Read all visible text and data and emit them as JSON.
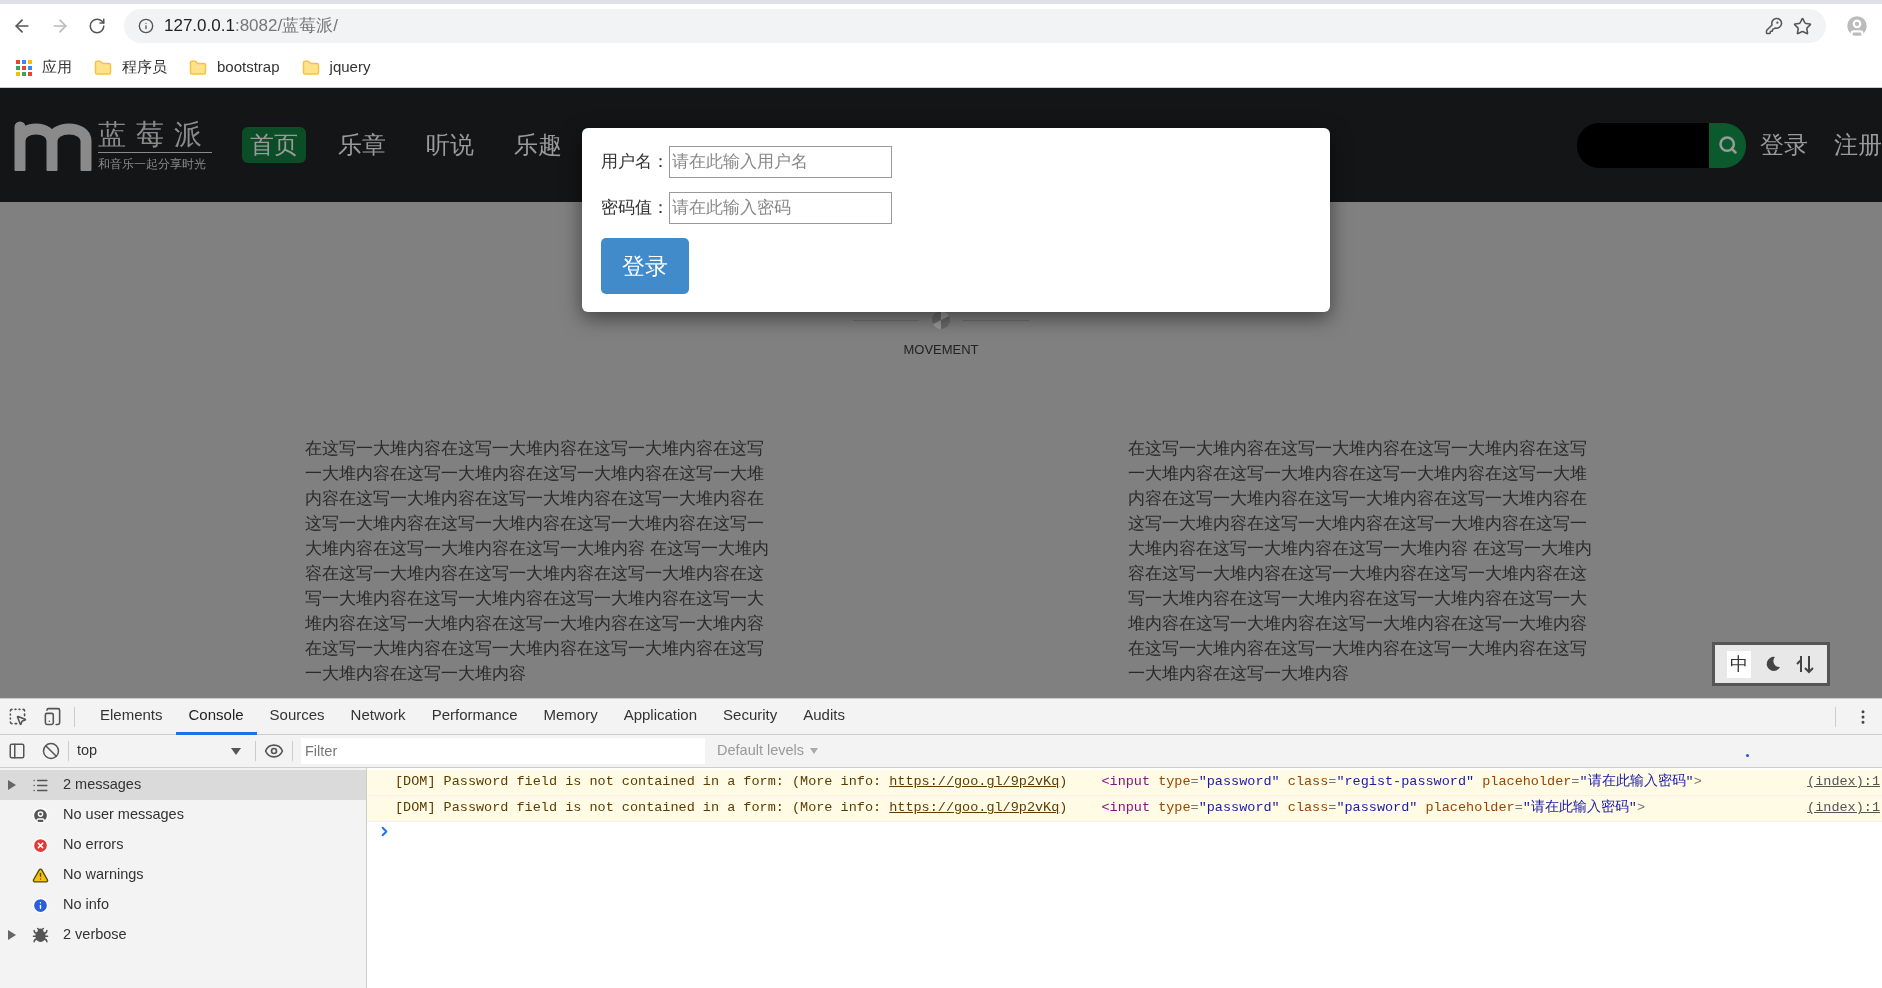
{
  "browser": {
    "url_host": "127.0.0.1",
    "url_path": ":8082/蓝莓派/",
    "bookmarks": [
      {
        "kind": "apps",
        "label": "应用"
      },
      {
        "kind": "folder",
        "label": "程序员"
      },
      {
        "kind": "folder",
        "label": "bootstrap"
      },
      {
        "kind": "folder",
        "label": "jquery"
      }
    ]
  },
  "site": {
    "logo_title": "蓝莓派",
    "logo_slogan": "和音乐一起分享时光",
    "nav": [
      {
        "label": "首页",
        "selected": true
      },
      {
        "label": "乐章",
        "selected": false
      },
      {
        "label": "听说",
        "selected": false
      },
      {
        "label": "乐趣",
        "selected": false
      }
    ],
    "auth_links": [
      "登录",
      "注册"
    ],
    "section_label": "MOVEMENT",
    "paragraphs": [
      "在这写一大堆内容在这写一大堆内容在这写一大堆内容在这写一大堆内容在这写一大堆内容在这写一大堆内容在这写一大堆内容在这写一大堆内容在这写一大堆内容在这写一大堆内容在这写一大堆内容在这写一大堆内容在这写一大堆内容在这写一大堆内容在这写一大堆内容在这写一大堆内容 在这写一大堆内容在这写一大堆内容在这写一大堆内容在这写一大堆内容在这写一大堆内容在这写一大堆内容在这写一大堆内容在这写一大堆内容在这写一大堆内容在这写一大堆内容在这写一大堆内容在这写一大堆内容在这写一大堆内容在这写一大堆内容在这写一大堆内容在这写一大堆内容",
      "在这写一大堆内容在这写一大堆内容在这写一大堆内容在这写一大堆内容在这写一大堆内容在这写一大堆内容在这写一大堆内容在这写一大堆内容在这写一大堆内容在这写一大堆内容在这写一大堆内容在这写一大堆内容在这写一大堆内容在这写一大堆内容在这写一大堆内容在这写一大堆内容 在这写一大堆内容在这写一大堆内容在这写一大堆内容在这写一大堆内容在这写一大堆内容在这写一大堆内容在这写一大堆内容在这写一大堆内容在这写一大堆内容在这写一大堆内容在这写一大堆内容在这写一大堆内容在这写一大堆内容在这写一大堆内容在这写一大堆内容在这写一大堆内容"
    ],
    "widget": {
      "label": "中"
    }
  },
  "login_dialog": {
    "fields": [
      {
        "label": "用户名：",
        "placeholder": "请在此输入用户名"
      },
      {
        "label": "密码值：",
        "placeholder": "请在此输入密码"
      }
    ],
    "button": "登录"
  },
  "devtools": {
    "tabs": [
      {
        "label": "Elements",
        "selected": false
      },
      {
        "label": "Console",
        "selected": true
      },
      {
        "label": "Sources",
        "selected": false
      },
      {
        "label": "Network",
        "selected": false
      },
      {
        "label": "Performance",
        "selected": false
      },
      {
        "label": "Memory",
        "selected": false
      },
      {
        "label": "Application",
        "selected": false
      },
      {
        "label": "Security",
        "selected": false
      },
      {
        "label": "Audits",
        "selected": false
      }
    ],
    "context": "top",
    "filter_placeholder": "Filter",
    "levels": "Default levels",
    "sidebar": [
      {
        "kind": "messages",
        "label": "2 messages",
        "selected": true,
        "expandable": true
      },
      {
        "kind": "user",
        "label": "No user messages",
        "selected": false,
        "expandable": false
      },
      {
        "kind": "errors",
        "label": "No errors",
        "selected": false,
        "expandable": false
      },
      {
        "kind": "warnings",
        "label": "No warnings",
        "selected": false,
        "expandable": false
      },
      {
        "kind": "info",
        "label": "No info",
        "selected": false,
        "expandable": false
      },
      {
        "kind": "verbose",
        "label": "2 verbose",
        "selected": false,
        "expandable": true
      }
    ],
    "messages": [
      {
        "kind": "warning",
        "text": "[DOM] Password field is not contained in a form: (More info: ",
        "link": "https://goo.gl/9p2vKq",
        "after": ")",
        "source": "(index):1",
        "code": [
          {
            "kind": "tag",
            "t": "<input"
          },
          {
            "kind": "attr",
            "t": " type"
          },
          {
            "kind": "p",
            "t": "="
          },
          {
            "kind": "val",
            "t": "\"password\""
          },
          {
            "kind": "attr",
            "t": " class"
          },
          {
            "kind": "p",
            "t": "="
          },
          {
            "kind": "val",
            "t": "\"regist-password\""
          },
          {
            "kind": "attr",
            "t": " placeholder"
          },
          {
            "kind": "p",
            "t": "="
          },
          {
            "kind": "val",
            "t": "\"请在此输入密码\""
          },
          {
            "kind": "p",
            "t": ">"
          }
        ]
      },
      {
        "kind": "warning",
        "text": "[DOM] Password field is not contained in a form: (More info: ",
        "link": "https://goo.gl/9p2vKq",
        "after": ")",
        "source": "(index):1",
        "code": [
          {
            "kind": "tag",
            "t": "<input"
          },
          {
            "kind": "attr",
            "t": " type"
          },
          {
            "kind": "p",
            "t": "="
          },
          {
            "kind": "val",
            "t": "\"password\""
          },
          {
            "kind": "attr",
            "t": " class"
          },
          {
            "kind": "p",
            "t": "="
          },
          {
            "kind": "val",
            "t": "\"password\""
          },
          {
            "kind": "attr",
            "t": " placeholder"
          },
          {
            "kind": "p",
            "t": "="
          },
          {
            "kind": "val",
            "t": "\"请在此输入密码\""
          },
          {
            "kind": "p",
            "t": ">"
          }
        ]
      }
    ]
  }
}
